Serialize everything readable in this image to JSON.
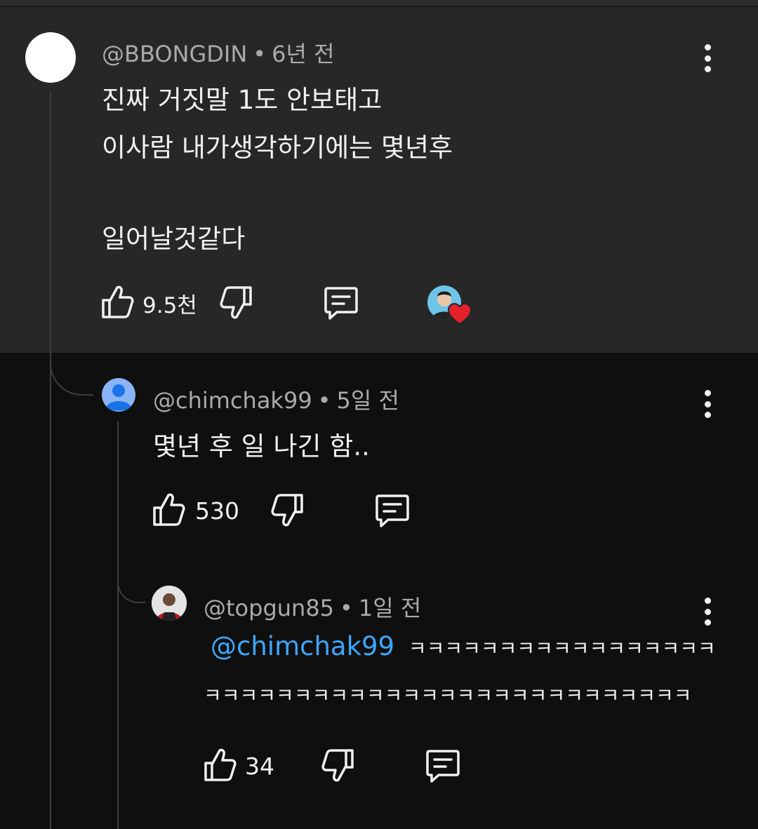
{
  "comments": [
    {
      "author": "@BBONGDIN",
      "time": "6년 전",
      "lines": [
        "진짜 거짓말 1도 안보태고",
        "이사람 내가생각하기에는 몇년후",
        "일어날것같다"
      ],
      "likes": "9.5천",
      "hearted": true
    },
    {
      "author": "@chimchak99",
      "time": "5일 전",
      "lines": [
        "몇년 후 일 나긴 함.."
      ],
      "likes": "530"
    },
    {
      "author": "@topgun85",
      "time": "1일 전",
      "mention": "@chimchak99",
      "lines": [
        "ㅋㅋㅋㅋㅋㅋㅋㅋㅋㅋㅋㅋㅋㅋㅋㅋㅋㅋㅋㅋㅋㅋㅋㅋㅋㅋㅋㅋㅋㅋㅋㅋㅋㅋ"
      ],
      "line1_rest": "ㅋㅋㅋㅋㅋㅋㅋㅋㅋㅋㅋㅋㅋㅋㅋㅋㅋ",
      "line2": "ㅋㅋㅋㅋㅋㅋㅋㅋㅋㅋㅋㅋㅋㅋㅋㅋㅋㅋㅋㅋㅋㅋㅋㅋㅋㅋㅋ",
      "likes": "34"
    }
  ],
  "colors": {
    "background": "#0f0f0f",
    "highlight": "#272727",
    "mention": "#3ea6ff",
    "heart": "#e5212b"
  }
}
